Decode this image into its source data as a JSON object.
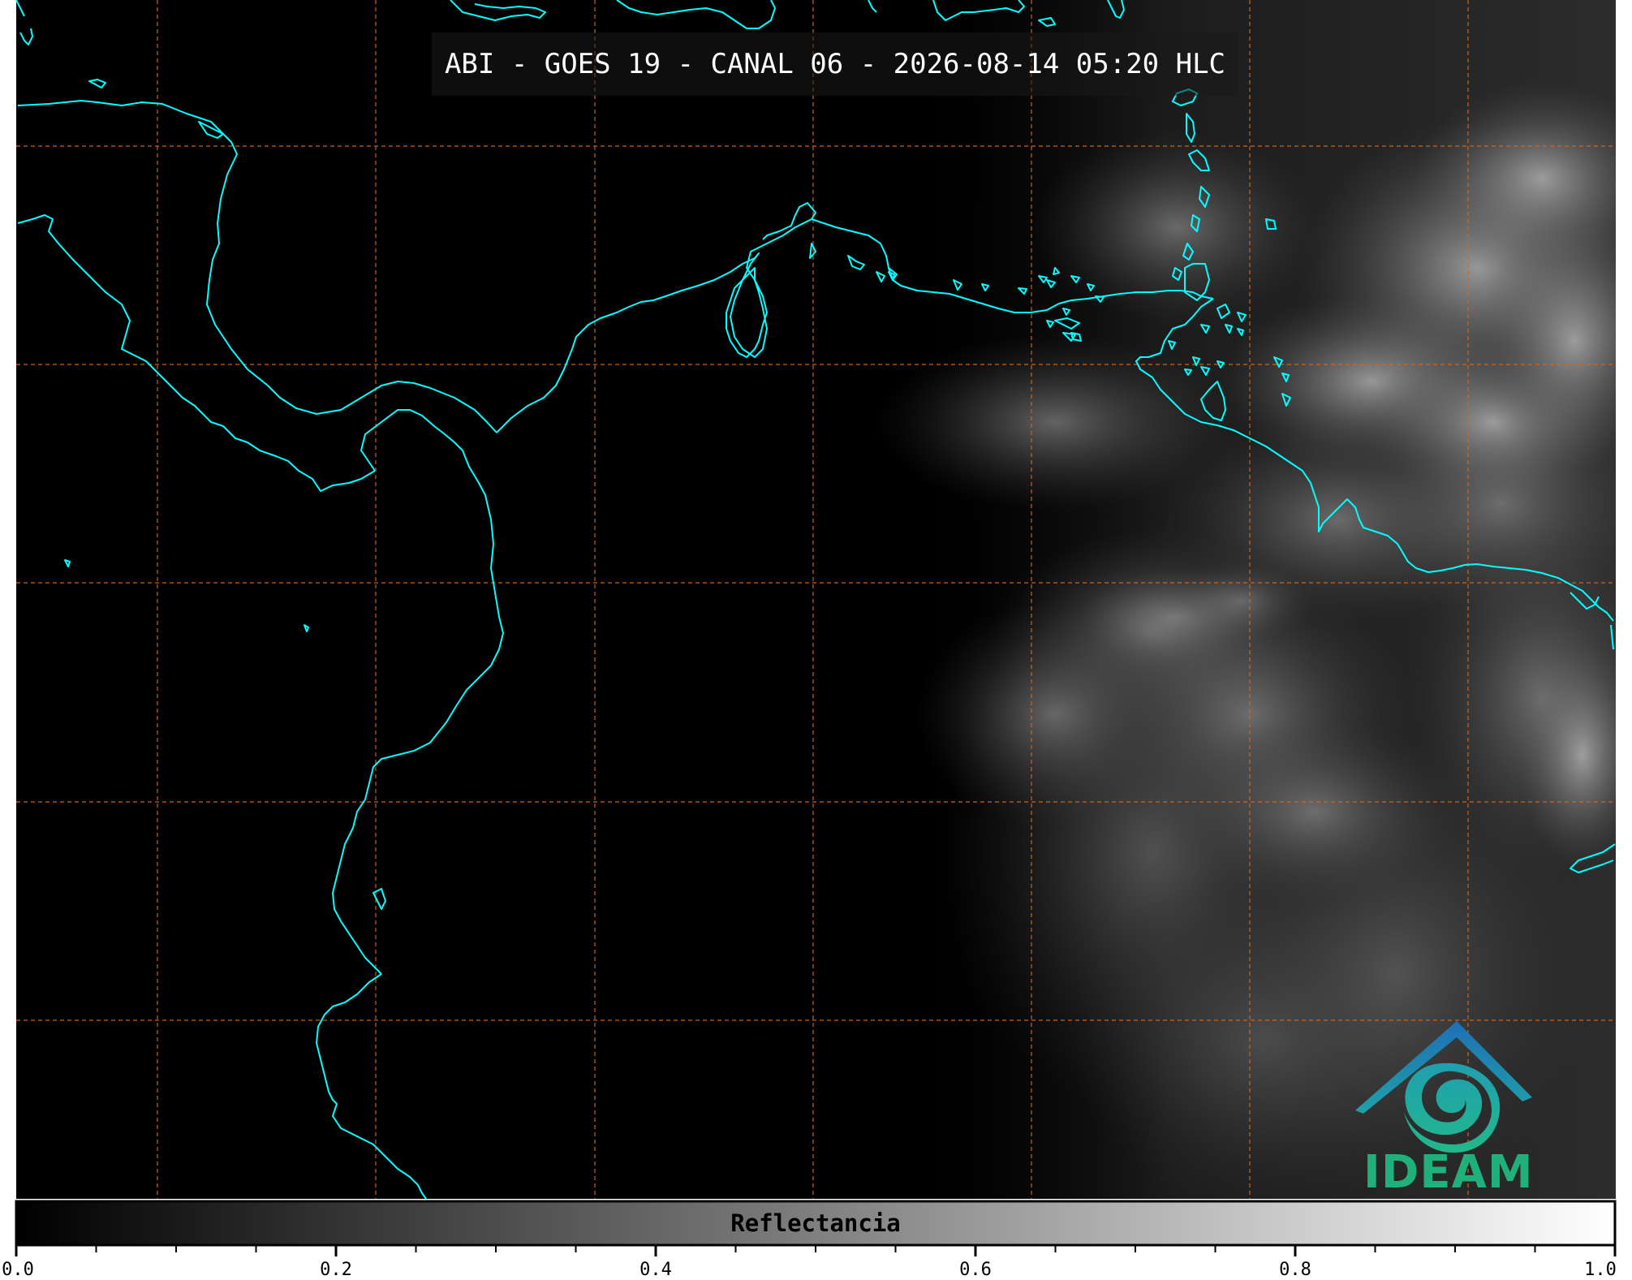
{
  "title": "ABI - GOES 19 - CANAL 06 - 2026-08-14 05:20 HLC",
  "colorbar": {
    "label": "Reflectancia",
    "ticks": [
      "0.0",
      "0.2",
      "0.4",
      "0.6",
      "0.8",
      "1.0"
    ],
    "range": [
      0.0,
      1.0
    ],
    "minor_step": 0.05,
    "colormap": [
      "#000000",
      "#ffffff"
    ]
  },
  "map": {
    "coastline_color": "#00ffff",
    "graticule_color": "#d2691e",
    "graticule_style": "dashed",
    "background": "#000000"
  },
  "logo": {
    "text": "IDEAM",
    "roof_color": "#1f6fb5",
    "swirl_color": "#1fb59a",
    "text_color": "#20b07c"
  }
}
